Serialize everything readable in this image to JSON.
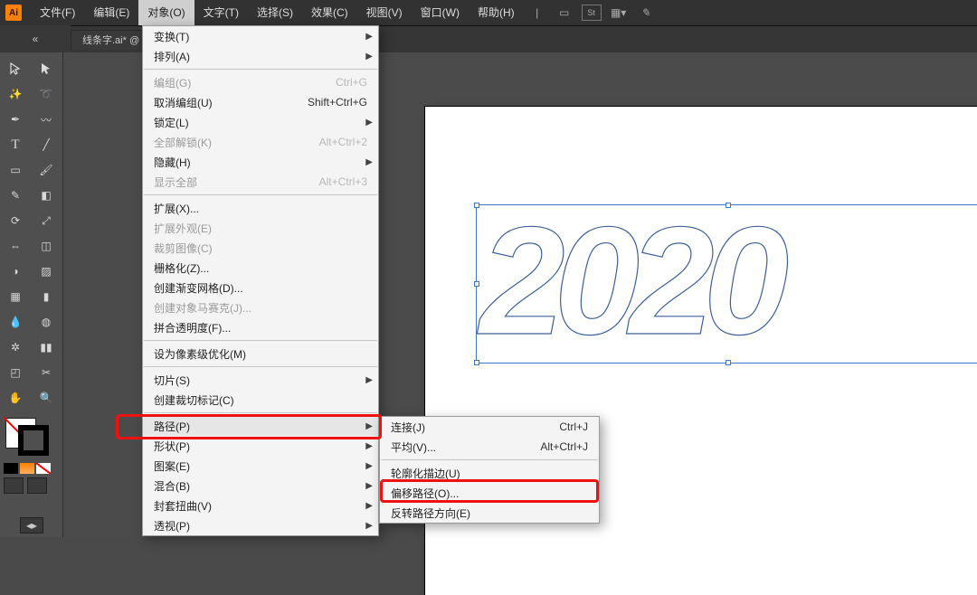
{
  "app": {
    "logo_text": "Ai"
  },
  "menubar": {
    "items": [
      {
        "label": "文件(F)"
      },
      {
        "label": "编辑(E)"
      },
      {
        "label": "对象(O)",
        "active": true
      },
      {
        "label": "文字(T)"
      },
      {
        "label": "选择(S)"
      },
      {
        "label": "效果(C)"
      },
      {
        "label": "视图(V)"
      },
      {
        "label": "窗口(W)"
      },
      {
        "label": "帮助(H)"
      }
    ]
  },
  "tab": {
    "title": "线条字.ai*  @"
  },
  "canvas": {
    "text_value": "2020"
  },
  "object_menu": [
    {
      "label": "变换(T)",
      "submenu": true
    },
    {
      "label": "排列(A)",
      "submenu": true
    },
    {
      "sep": true
    },
    {
      "label": "编组(G)",
      "shortcut": "Ctrl+G",
      "disabled": true
    },
    {
      "label": "取消编组(U)",
      "shortcut": "Shift+Ctrl+G"
    },
    {
      "label": "锁定(L)",
      "submenu": true
    },
    {
      "label": "全部解锁(K)",
      "shortcut": "Alt+Ctrl+2",
      "disabled": true
    },
    {
      "label": "隐藏(H)",
      "submenu": true
    },
    {
      "label": "显示全部",
      "shortcut": "Alt+Ctrl+3",
      "disabled": true
    },
    {
      "sep": true
    },
    {
      "label": "扩展(X)..."
    },
    {
      "label": "扩展外观(E)",
      "disabled": true
    },
    {
      "label": "裁剪图像(C)",
      "disabled": true
    },
    {
      "label": "栅格化(Z)..."
    },
    {
      "label": "创建渐变网格(D)..."
    },
    {
      "label": "创建对象马赛克(J)...",
      "disabled": true
    },
    {
      "label": "拼合透明度(F)..."
    },
    {
      "sep": true
    },
    {
      "label": "设为像素级优化(M)"
    },
    {
      "sep": true
    },
    {
      "label": "切片(S)",
      "submenu": true
    },
    {
      "label": "创建裁切标记(C)"
    },
    {
      "sep": true
    },
    {
      "label": "路径(P)",
      "submenu": true,
      "hover": true
    },
    {
      "label": "形状(P)",
      "submenu": true
    },
    {
      "label": "图案(E)",
      "submenu": true
    },
    {
      "label": "混合(B)",
      "submenu": true
    },
    {
      "label": "封套扭曲(V)",
      "submenu": true
    },
    {
      "label": "透视(P)",
      "submenu": true
    }
  ],
  "path_submenu": [
    {
      "label": "连接(J)",
      "shortcut": "Ctrl+J"
    },
    {
      "label": "平均(V)...",
      "shortcut": "Alt+Ctrl+J"
    },
    {
      "sep": true
    },
    {
      "label": "轮廓化描边(U)"
    },
    {
      "label": "偏移路径(O)..."
    },
    {
      "label": "反转路径方向(E)"
    }
  ]
}
